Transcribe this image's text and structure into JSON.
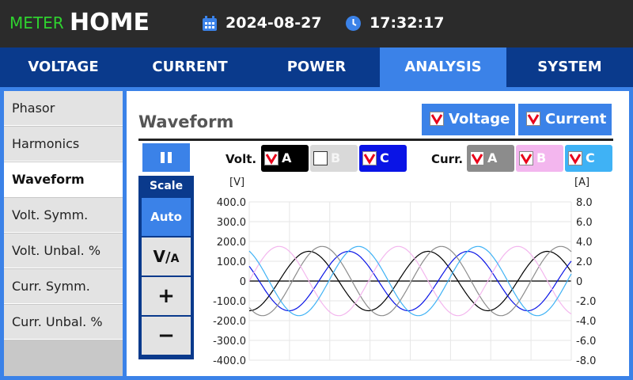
{
  "header": {
    "brand": "METER",
    "page": "HOME",
    "date": "2024-08-27",
    "time": "17:32:17",
    "icons": {
      "date": "calendar-icon",
      "time": "clock-icon"
    }
  },
  "tabs": [
    {
      "label": "VOLTAGE",
      "active": false
    },
    {
      "label": "CURRENT",
      "active": false
    },
    {
      "label": "POWER",
      "active": false
    },
    {
      "label": "ANALYSIS",
      "active": true
    },
    {
      "label": "SYSTEM",
      "active": false
    }
  ],
  "sidebar": {
    "items": [
      {
        "label": "Phasor",
        "active": false
      },
      {
        "label": "Harmonics",
        "active": false
      },
      {
        "label": "Waveform",
        "active": true
      },
      {
        "label": "Volt. Symm.",
        "active": false
      },
      {
        "label": "Volt. Unbal. %",
        "active": false
      },
      {
        "label": "Curr. Symm.",
        "active": false
      },
      {
        "label": "Curr. Unbal. %",
        "active": false
      }
    ]
  },
  "main": {
    "title": "Waveform",
    "toggles": [
      {
        "label": "Voltage",
        "checked": true
      },
      {
        "label": "Current",
        "checked": true
      }
    ],
    "pause_icon": "pause-icon",
    "scale": {
      "title": "Scale",
      "auto": "Auto",
      "unit_main": "V",
      "unit_sep": "/",
      "unit_alt": "A",
      "plus": "+",
      "minus": "−"
    },
    "voltage_channels": {
      "label": "Volt.",
      "items": [
        {
          "name": "A",
          "checked": true,
          "bg": "#000000"
        },
        {
          "name": "B",
          "checked": false,
          "bg": "#d9d9d9"
        },
        {
          "name": "C",
          "checked": true,
          "bg": "#0a14e6"
        }
      ]
    },
    "current_channels": {
      "label": "Curr.",
      "items": [
        {
          "name": "A",
          "checked": true,
          "bg": "#8c8c8c"
        },
        {
          "name": "B",
          "checked": true,
          "bg": "#f3b6ee"
        },
        {
          "name": "C",
          "checked": true,
          "bg": "#3fb2f5"
        }
      ]
    }
  },
  "colors": {
    "accent": "#3b82e8",
    "navy": "#0a3a8c",
    "header": "#2b2b2b",
    "check": "#e8001a"
  },
  "chart_data": {
    "type": "line",
    "left_axis_unit": "[V]",
    "right_axis_unit": "[A]",
    "ylim_left": [
      -400,
      400
    ],
    "ylim_right": [
      -8,
      8
    ],
    "yticks_left": [
      "400.0",
      "300.0",
      "200.0",
      "100.0",
      "0",
      "-100.0",
      "-200.0",
      "-300.0",
      "-400.0"
    ],
    "yticks_right": [
      "8.0",
      "6.0",
      "4.0",
      "2.0",
      "0",
      "-2.0",
      "-4.0",
      "-6.0",
      "-8.0"
    ],
    "grid": true,
    "series": [
      {
        "name": "Volt. A",
        "axis": "left",
        "color": "#000000",
        "amplitude": 150,
        "phase_deg": -90,
        "periods": 2.7
      },
      {
        "name": "Volt. C",
        "axis": "left",
        "color": "#0a14e6",
        "amplitude": 150,
        "phase_deg": 150,
        "periods": 2.7
      },
      {
        "name": "Curr. A",
        "axis": "right",
        "color": "#8c8c8c",
        "amplitude": 3.5,
        "phase_deg": -130,
        "periods": 2.7
      },
      {
        "name": "Curr. B",
        "axis": "right",
        "color": "#f3b6ee",
        "amplitude": 3.5,
        "phase_deg": 0,
        "periods": 2.7
      },
      {
        "name": "Curr. C",
        "axis": "right",
        "color": "#3fb2f5",
        "amplitude": 3.5,
        "phase_deg": 120,
        "periods": 2.7
      }
    ]
  }
}
